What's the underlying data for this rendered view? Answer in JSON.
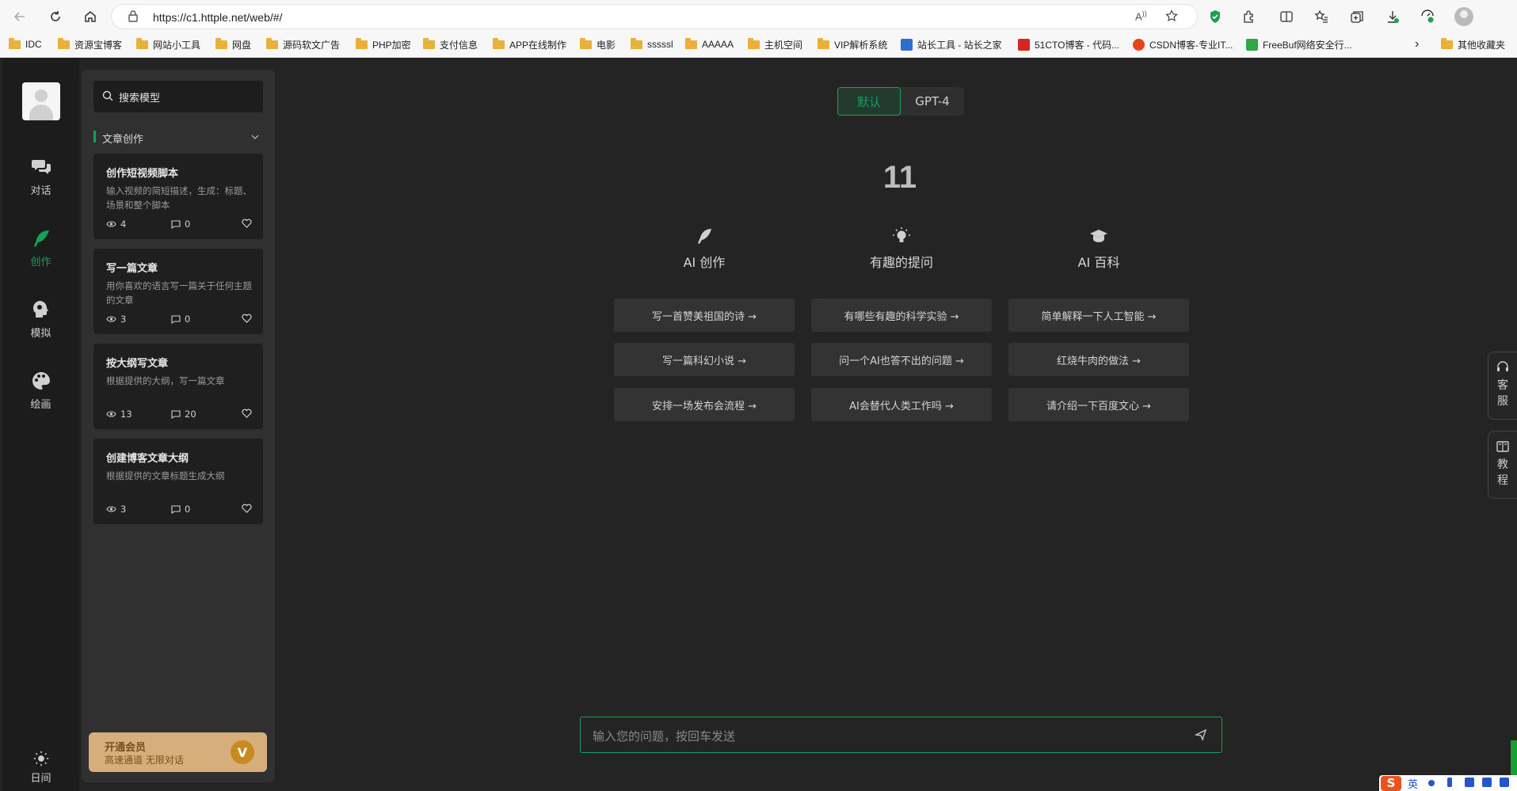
{
  "browser": {
    "url": "https://c1.httple.net/web/#/",
    "bookmarks": [
      "IDC",
      "资源宝博客",
      "网站小工具",
      "网盘",
      "源码软文广告",
      "PHP加密",
      "支付信息",
      "APP在线制作",
      "电影",
      "sssssl",
      "AAAAA",
      "主机空间",
      "VIP解析系统",
      "站长工具 - 站长之家",
      "51CTO博客 - 代码...",
      "CSDN博客-专业IT...",
      "FreeBuf网络安全行...",
      "其他收藏夹"
    ],
    "more_glyph": "›"
  },
  "rail": {
    "items": [
      {
        "label": "对话",
        "icon": "chat-icon"
      },
      {
        "label": "创作",
        "icon": "feather-icon"
      },
      {
        "label": "模拟",
        "icon": "head-icon"
      },
      {
        "label": "绘画",
        "icon": "palette-icon"
      }
    ],
    "theme_label": "日间"
  },
  "panel": {
    "search_placeholder": "搜索模型",
    "category": "文章创作",
    "cards": [
      {
        "title": "创作短视频脚本",
        "desc": "输入视频的简短描述，生成：标题、场景和整个脚本",
        "views": "4",
        "comments": "0"
      },
      {
        "title": "写一篇文章",
        "desc": "用你喜欢的语言写一篇关于任何主题的文章",
        "views": "3",
        "comments": "0"
      },
      {
        "title": "按大纲写文章",
        "desc": "根据提供的大纲，写一篇文章",
        "views": "13",
        "comments": "20"
      },
      {
        "title": "创建博客文章大纲",
        "desc": "根据提供的文章标题生成大纲",
        "views": "3",
        "comments": "0"
      }
    ],
    "vip": {
      "title": "开通会员",
      "subtitle": "高速通道 无限对话",
      "badge": "V"
    }
  },
  "main": {
    "tabs": [
      "默认",
      "GPT-4"
    ],
    "count": "11",
    "columns": [
      {
        "title": "AI 创作",
        "icon": "feather-icon",
        "prompts": [
          "写一首赞美祖国的诗 →",
          "写一篇科幻小说 →",
          "安排一场发布会流程 →"
        ]
      },
      {
        "title": "有趣的提问",
        "icon": "lightbulb-icon",
        "prompts": [
          "有哪些有趣的科学实验 →",
          "问一个AI也答不出的问题 →",
          "AI会替代人类工作吗 →"
        ]
      },
      {
        "title": "AI 百科",
        "icon": "graduation-cap-icon",
        "prompts": [
          "简单解释一下人工智能 →",
          "红烧牛肉的做法 →",
          "请介绍一下百度文心 →"
        ]
      }
    ],
    "input_placeholder": "输入您的问题，按回车发送"
  },
  "side_tabs": [
    {
      "label": "客服",
      "icon": "headset-icon"
    },
    {
      "label": "教程",
      "icon": "book-icon"
    }
  ],
  "ime": {
    "logo": "S",
    "lang": "英"
  },
  "colors": {
    "accent": "#18a058",
    "vip_bg": "#d7ae7b"
  }
}
